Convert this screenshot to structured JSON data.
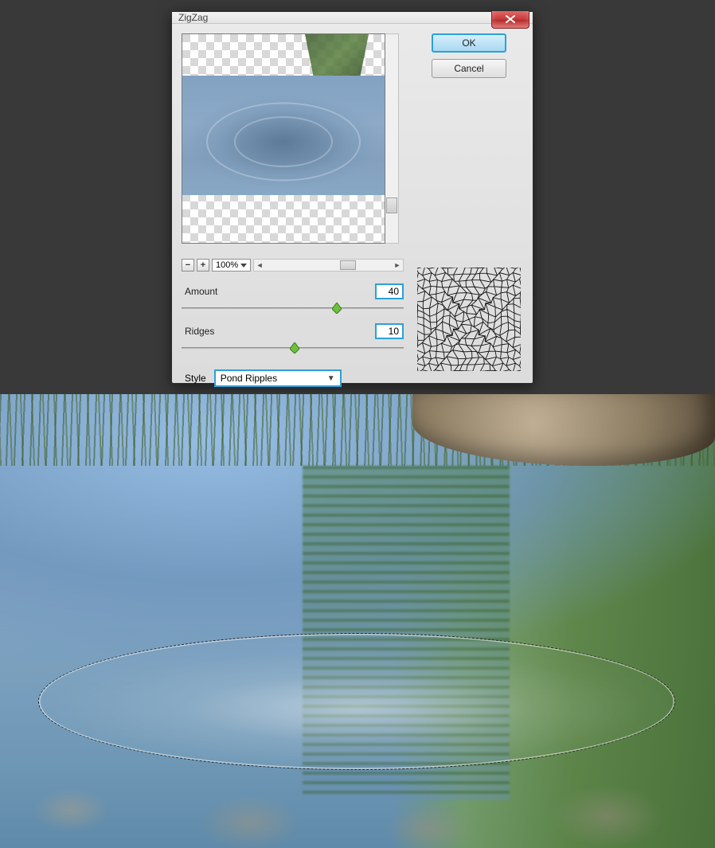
{
  "dialog": {
    "title": "ZigZag",
    "ok_label": "OK",
    "cancel_label": "Cancel",
    "zoom": {
      "minus": "−",
      "plus": "+",
      "value": "100%"
    },
    "amount": {
      "label": "Amount",
      "value": "40",
      "handle_pct": 70
    },
    "ridges": {
      "label": "Ridges",
      "value": "10",
      "handle_pct": 51
    },
    "style": {
      "label": "Style",
      "selected": "Pond Ripples"
    }
  }
}
